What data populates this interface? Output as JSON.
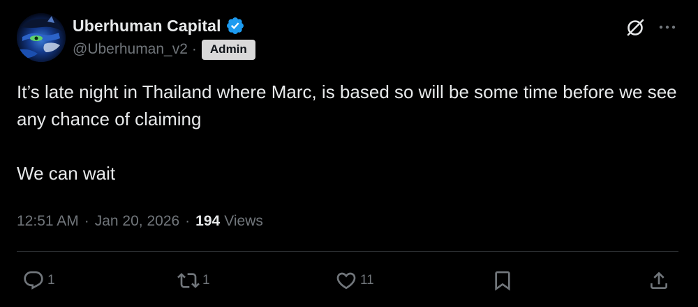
{
  "author": {
    "display_name": "Uberhuman Capital",
    "handle": "@Uberhuman_v2",
    "separator": "·",
    "badge": "Admin",
    "verified": true,
    "verified_color": "#1d9bf0"
  },
  "tweet": {
    "paragraphs": [
      "It’s late night in Thailand where Marc, is based so will be some time before we see any chance of claiming",
      "We can wait"
    ]
  },
  "meta": {
    "time": "12:51 AM",
    "separator": "·",
    "date": "Jan 20, 2026",
    "views_count": "194",
    "views_label": "Views"
  },
  "actions": {
    "replies": "1",
    "reposts": "1",
    "likes": "11"
  },
  "icons": {
    "grok": "grok-icon",
    "more": "more-icon",
    "reply": "reply-icon",
    "repost": "repost-icon",
    "like": "heart-icon",
    "bookmark": "bookmark-icon",
    "share": "share-icon"
  },
  "colors": {
    "background": "#000000",
    "text": "#e7e9ea",
    "muted": "#71767b",
    "divider": "#2f3336",
    "badge_bg": "#d9d9d9"
  }
}
